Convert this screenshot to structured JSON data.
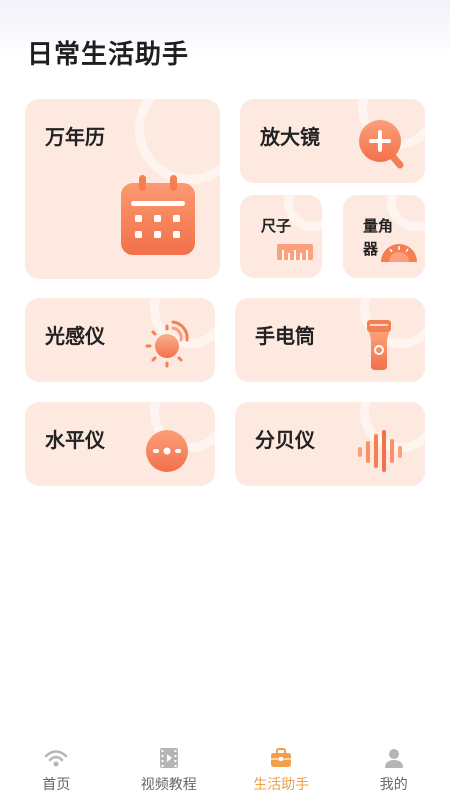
{
  "page": {
    "title": "日常生活助手"
  },
  "tools": {
    "calendar": {
      "label": "万年历",
      "icon": "calendar-icon"
    },
    "magnifier": {
      "label": "放大镜",
      "icon": "magnifier-plus-icon"
    },
    "ruler": {
      "label": "尺子",
      "icon": "ruler-icon"
    },
    "protractor": {
      "label_line1": "量角",
      "label_line2": "器",
      "icon": "protractor-icon"
    },
    "light_meter": {
      "label": "光感仪",
      "icon": "sun-icon"
    },
    "flashlight": {
      "label": "手电筒",
      "icon": "flashlight-icon"
    },
    "level": {
      "label": "水平仪",
      "icon": "level-icon"
    },
    "decibel": {
      "label": "分贝仪",
      "icon": "sound-wave-icon"
    }
  },
  "nav": {
    "items": [
      {
        "label": "首页",
        "icon": "wifi-icon",
        "active": false
      },
      {
        "label": "视频教程",
        "icon": "video-icon",
        "active": false
      },
      {
        "label": "生活助手",
        "icon": "briefcase-icon",
        "active": true
      },
      {
        "label": "我的",
        "icon": "user-icon",
        "active": false
      }
    ]
  },
  "colors": {
    "card_bg": "#fde9df",
    "icon_orange": "#f47f52",
    "icon_orange_light": "#fbb490",
    "nav_active": "#f0a04b",
    "nav_inactive": "#999999"
  }
}
